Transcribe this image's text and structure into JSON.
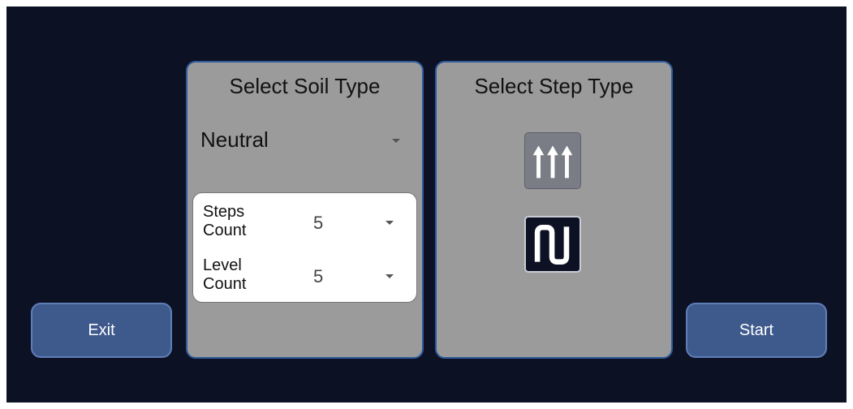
{
  "soil_panel": {
    "title": "Select Soil Type",
    "soil_type_selected": "Neutral",
    "steps_count_label": "Steps Count",
    "steps_count_value": "5",
    "level_count_label": "Level Count",
    "level_count_value": "5"
  },
  "step_panel": {
    "title": "Select Step Type",
    "options": [
      {
        "icon": "three-up-arrows-icon",
        "selected": true
      },
      {
        "icon": "serpentine-path-icon",
        "selected": false
      }
    ]
  },
  "buttons": {
    "exit_label": "Exit",
    "start_label": "Start"
  },
  "colors": {
    "background": "#0d1124",
    "panel": "#9b9b9b",
    "panel_border": "#2f5a9c",
    "button": "#3e5a8c"
  }
}
